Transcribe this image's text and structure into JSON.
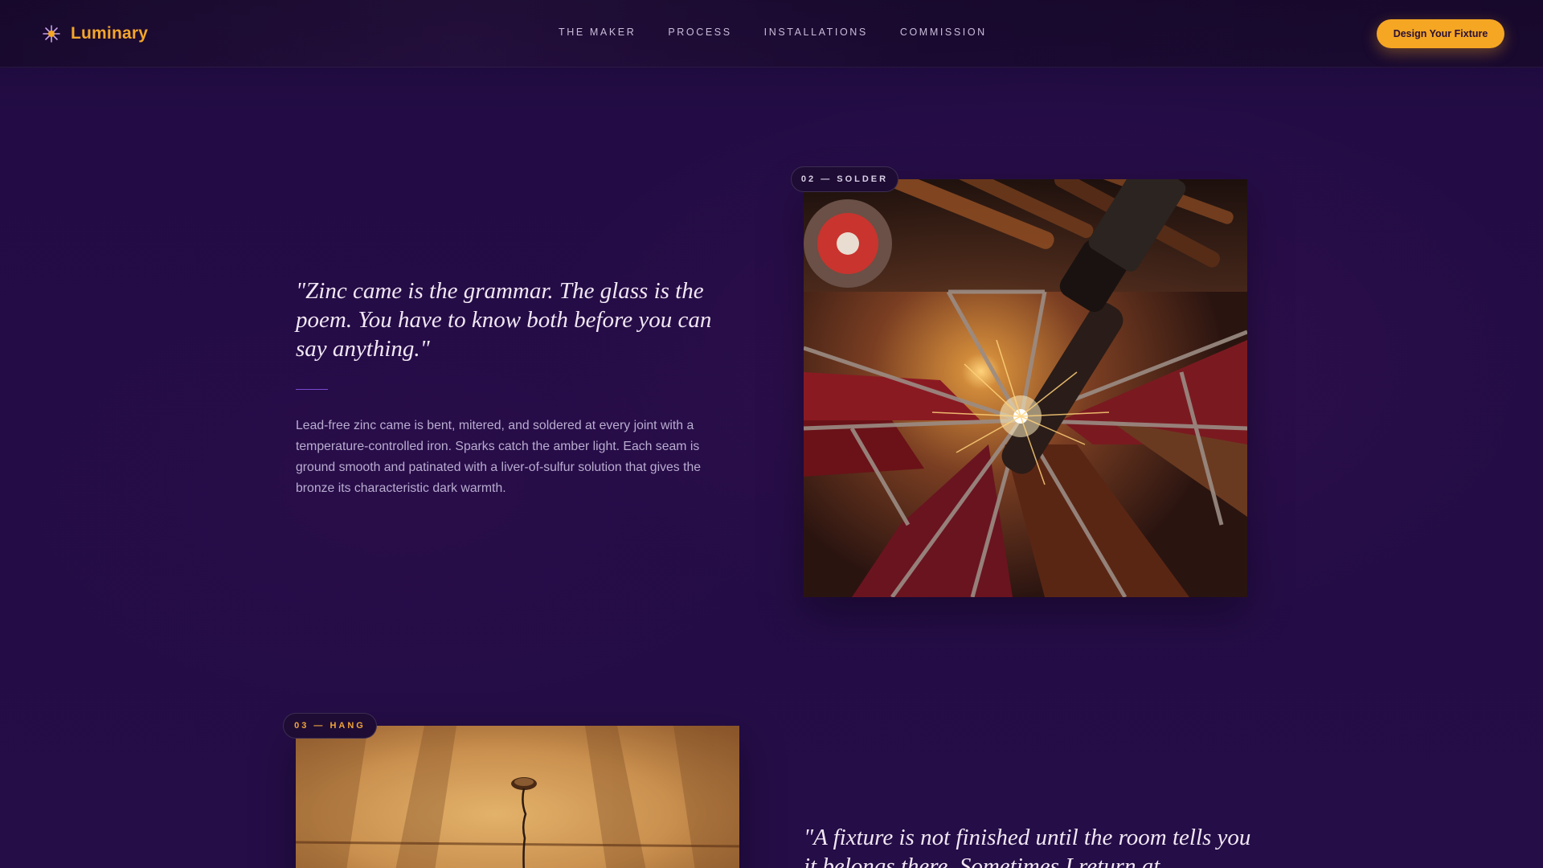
{
  "header": {
    "brand": "Luminary",
    "nav": [
      "THE MAKER",
      "PROCESS",
      "INSTALLATIONS",
      "COMMISSION"
    ],
    "cta_label": "Design Your Fixture"
  },
  "steps": [
    {
      "badge": "02 — SOLDER",
      "quote": "\"Zinc came is the grammar. The glass is the poem. You have to know both before you can say anything.\"",
      "body": "Lead-free zinc came is bent, mitered, and soldered at every joint with a temperature-controlled iron. Sparks catch the amber light. Each seam is ground smooth and patinated with a liver-of-sulfur solution that gives the bronze its characteristic dark warmth.",
      "image": "soldering-stained-glass-photo"
    },
    {
      "badge": "03 — HANG",
      "quote": "\"A fixture is not finished until the room tells you it belongs there. Sometimes I return at",
      "image": "pendant-ceiling-photo"
    }
  ],
  "colors": {
    "background": "#230c44",
    "accent": "#f5a623",
    "rule": "#7a4ad0",
    "text_muted": "#b9add0"
  },
  "icons": [
    "sparkle-logo-icon"
  ]
}
